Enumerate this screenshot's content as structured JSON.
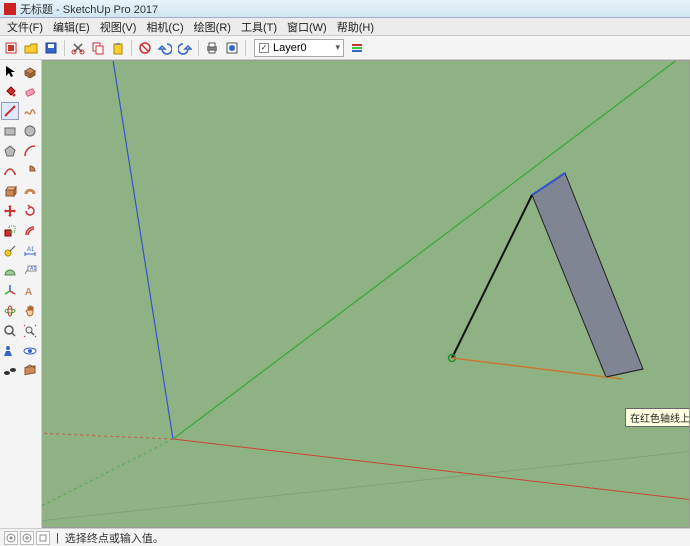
{
  "window": {
    "title": "无标题 - SketchUp Pro 2017"
  },
  "menu": {
    "file": "文件(F)",
    "edit": "编辑(E)",
    "view": "视图(V)",
    "camera": "相机(C)",
    "draw": "绘图(R)",
    "tools": "工具(T)",
    "window": "窗口(W)",
    "help": "帮助(H)"
  },
  "toolbar": {
    "layer_label": "Layer0"
  },
  "viewport": {
    "tooltip": "在红色轴线上"
  },
  "status": {
    "hint": "选择终点或输入值。"
  },
  "icons": {
    "new": "▦",
    "open": "📂",
    "save": "💾",
    "cut": "✂",
    "copy": "⎘",
    "paste": "📋",
    "delete": "⌫",
    "undo": "↶",
    "redo": "↷",
    "print": "🖨",
    "settings": "⚙",
    "info_i": "ⓘ",
    "info_q": "？",
    "divider": "|"
  }
}
